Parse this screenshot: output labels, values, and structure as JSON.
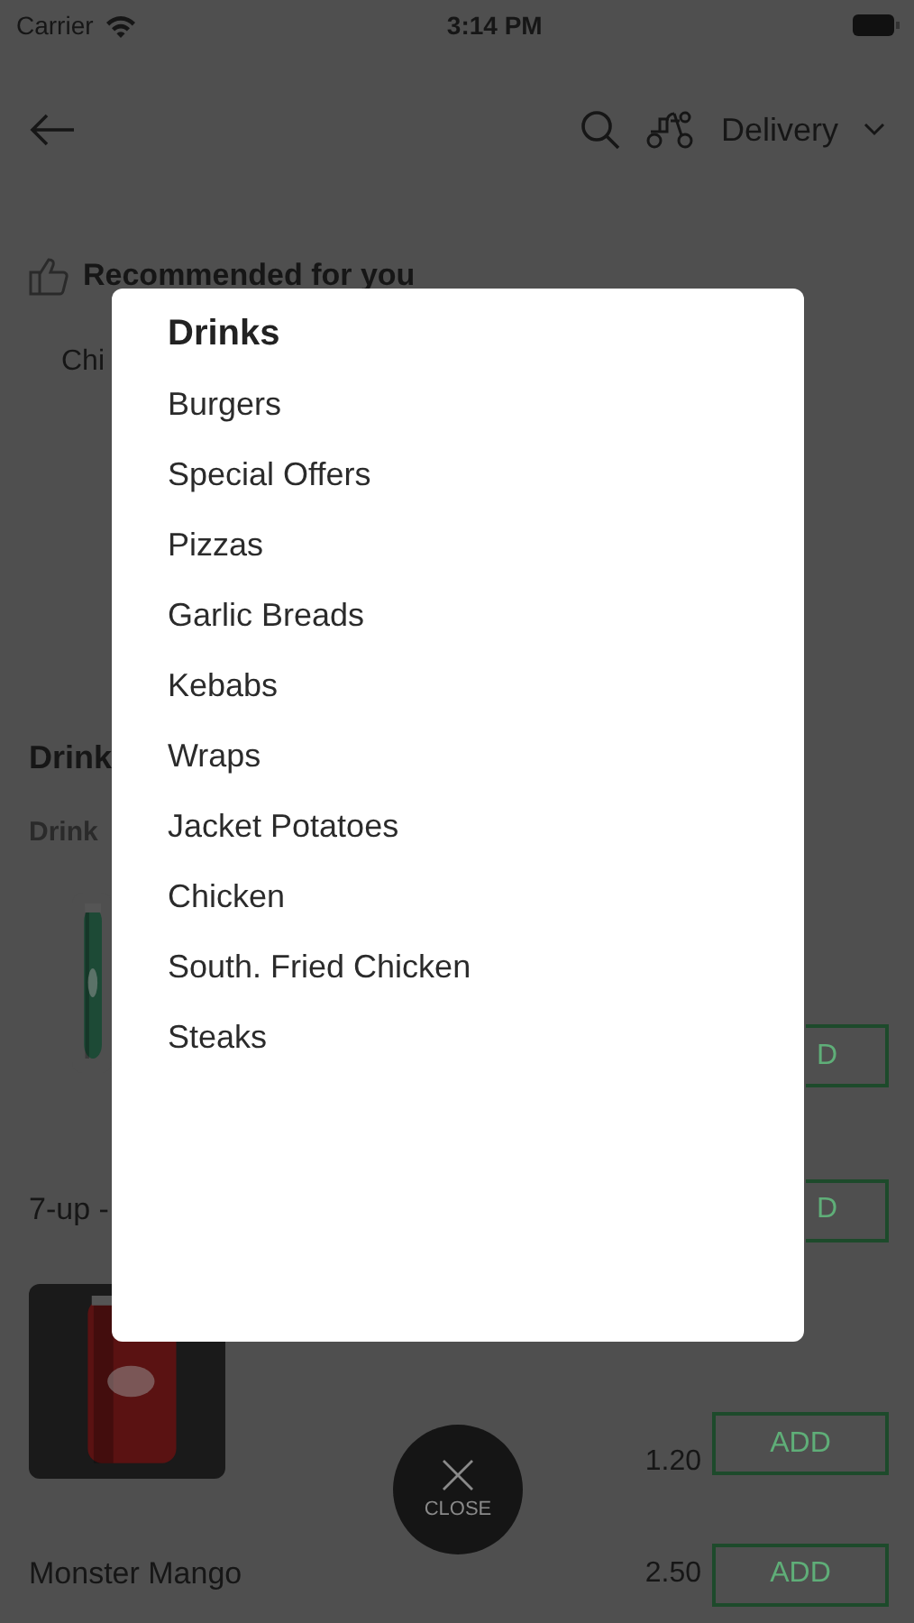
{
  "status_bar": {
    "carrier": "Carrier",
    "time": "3:14 PM"
  },
  "header": {
    "order_mode": "Delivery"
  },
  "recommended": {
    "title": "Recommended for you",
    "items": [
      "Chi"
    ]
  },
  "section": {
    "title": "Drink",
    "subtitle": "Drink"
  },
  "products": [
    {
      "button": "D"
    },
    {
      "kind": "text",
      "name": "7-up -",
      "button": "D"
    },
    {
      "price": "1.20",
      "button": "ADD"
    },
    {
      "kind": "text",
      "name": "Monster Mango",
      "price": "2.50",
      "button": "ADD"
    }
  ],
  "menu": {
    "title": "Drinks",
    "items": [
      "Burgers",
      "Special Offers",
      "Pizzas",
      "Garlic Breads",
      "Kebabs",
      "Wraps",
      "Jacket Potatoes",
      "Chicken",
      "South. Fried Chicken",
      "Steaks"
    ]
  },
  "close": {
    "label": "CLOSE"
  }
}
